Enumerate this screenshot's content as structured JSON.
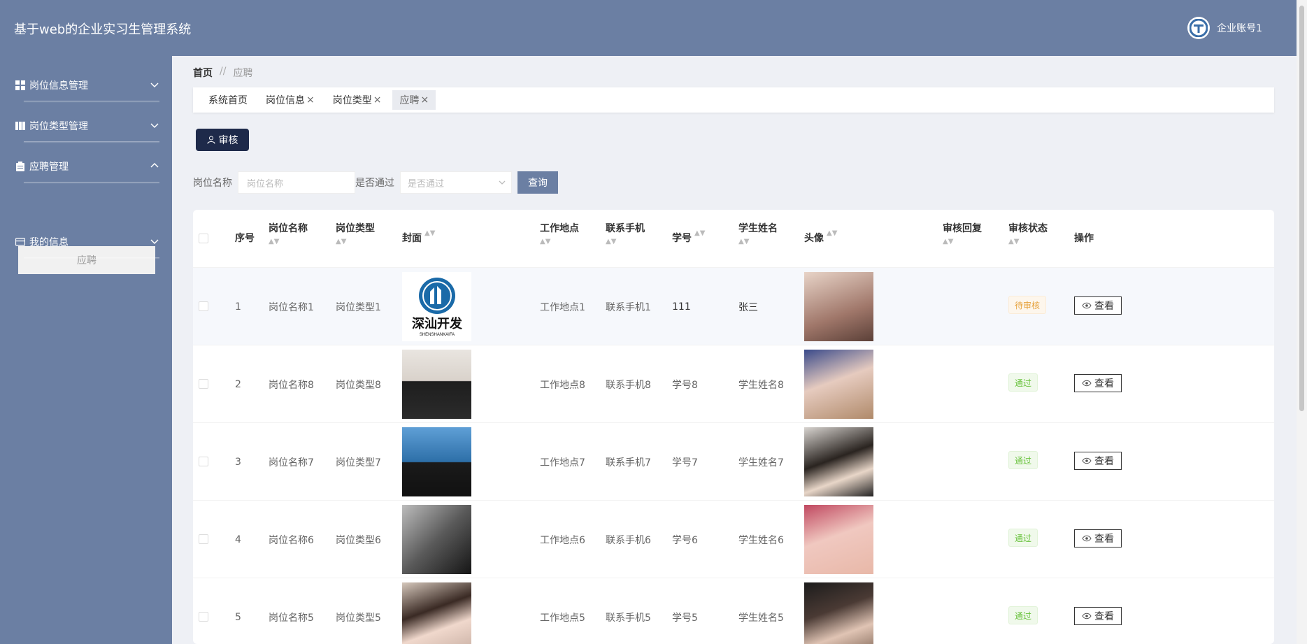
{
  "header": {
    "app_title": "基于web的企业实习生管理系统",
    "account_name": "企业账号1"
  },
  "sidebar": {
    "items": [
      {
        "label": "岗位信息管理"
      },
      {
        "label": "岗位类型管理"
      },
      {
        "label": "应聘管理"
      },
      {
        "label": "我的信息"
      }
    ],
    "submenu_active": "应聘"
  },
  "breadcrumb": {
    "home": "首页",
    "separator": "//",
    "current": "应聘"
  },
  "tabs": [
    {
      "label": "系统首页",
      "close": ""
    },
    {
      "label": "岗位信息",
      "close": "×"
    },
    {
      "label": "岗位类型",
      "close": "×"
    },
    {
      "label": "应聘",
      "close": "×"
    }
  ],
  "toolbar": {
    "audit_label": "审核"
  },
  "search": {
    "job_label": "岗位名称",
    "job_placeholder": "岗位名称",
    "pass_label": "是否通过",
    "pass_placeholder": "是否通过",
    "query_label": "查询"
  },
  "table": {
    "headers": {
      "index": "序号",
      "job_name": "岗位名称",
      "job_type": "岗位类型",
      "cover": "封面",
      "location": "工作地点",
      "phone": "联系手机",
      "student_no": "学号",
      "student_name": "学生姓名",
      "avatar": "头像",
      "reply": "审核回复",
      "status": "审核状态",
      "actions": "操作"
    },
    "sort_glyph": "▲▼",
    "view_label": "查看",
    "rows": [
      {
        "index": "1",
        "job_name": "岗位名称1",
        "job_type": "岗位类型1",
        "location": "工作地点1",
        "phone": "联系手机1",
        "student_no": "111",
        "student_name": "张三",
        "status": "待审核",
        "status_kind": "pending",
        "cover_logo_text": "深汕开发",
        "cover_logo_sub": "SHENSHANKAIFA"
      },
      {
        "index": "2",
        "job_name": "岗位名称8",
        "job_type": "岗位类型8",
        "location": "工作地点8",
        "phone": "联系手机8",
        "student_no": "学号8",
        "student_name": "学生姓名8",
        "status": "通过",
        "status_kind": "passed"
      },
      {
        "index": "3",
        "job_name": "岗位名称7",
        "job_type": "岗位类型7",
        "location": "工作地点7",
        "phone": "联系手机7",
        "student_no": "学号7",
        "student_name": "学生姓名7",
        "status": "通过",
        "status_kind": "passed"
      },
      {
        "index": "4",
        "job_name": "岗位名称6",
        "job_type": "岗位类型6",
        "location": "工作地点6",
        "phone": "联系手机6",
        "student_no": "学号6",
        "student_name": "学生姓名6",
        "status": "通过",
        "status_kind": "passed"
      },
      {
        "index": "5",
        "job_name": "岗位名称5",
        "job_type": "岗位类型5",
        "location": "工作地点5",
        "phone": "联系手机5",
        "student_no": "学号5",
        "student_name": "学生姓名5",
        "status": "通过",
        "status_kind": "passed"
      }
    ]
  },
  "colors": {
    "brand": "#6b7fa3",
    "dark_button": "#1e2a4a",
    "pending": "#e6a23c",
    "passed": "#67c23a"
  }
}
